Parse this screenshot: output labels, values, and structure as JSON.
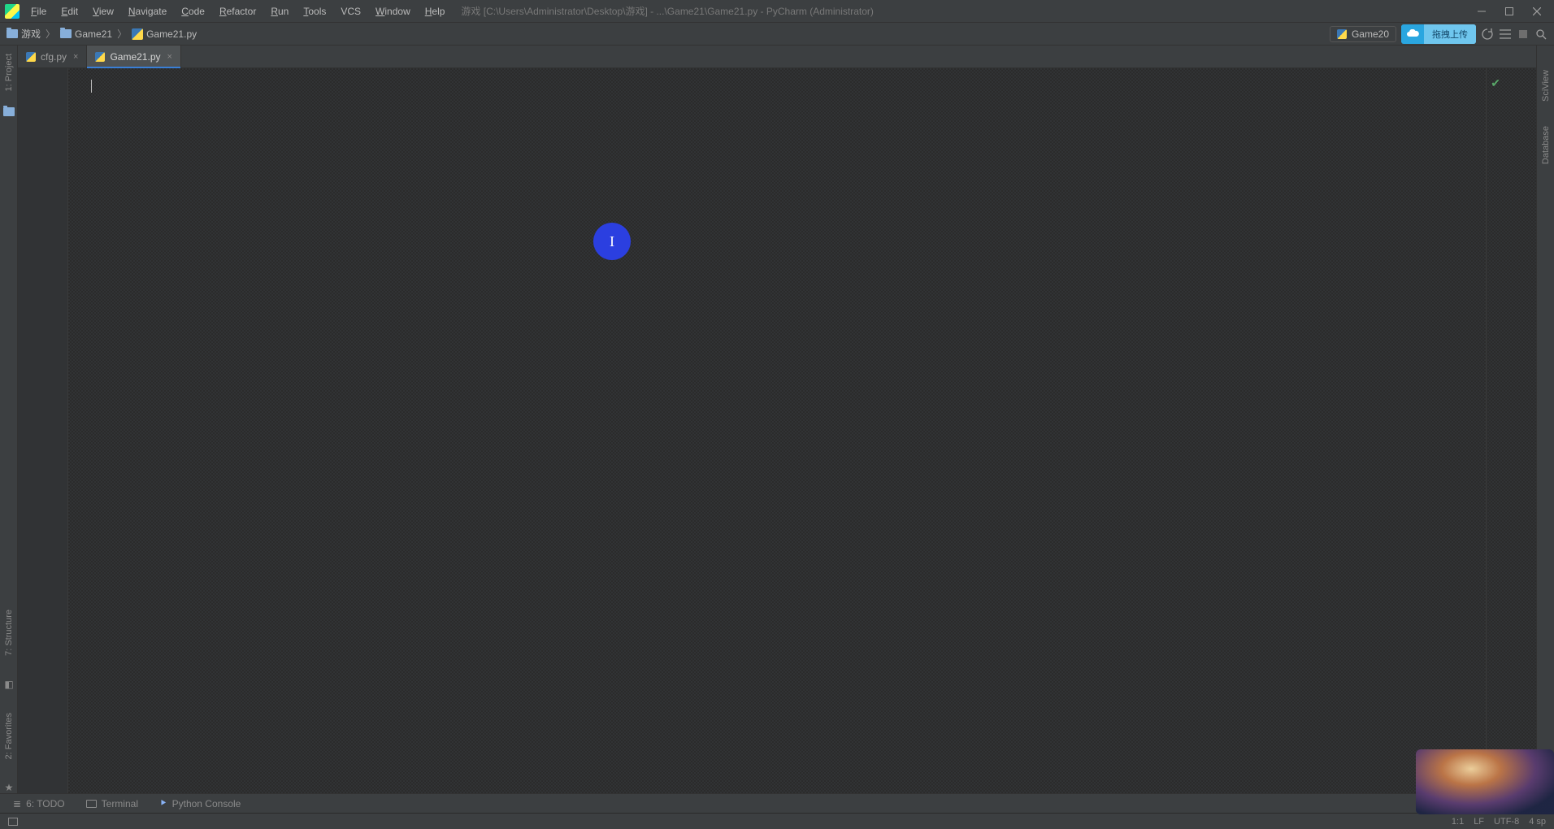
{
  "menu": {
    "file": "File",
    "edit": "Edit",
    "view": "View",
    "navigate": "Navigate",
    "code": "Code",
    "refactor": "Refactor",
    "run": "Run",
    "tools": "Tools",
    "vcs": "VCS",
    "window": "Window",
    "help": "Help"
  },
  "title": "游戏 [C:\\Users\\Administrator\\Desktop\\游戏] - ...\\Game21\\Game21.py - PyCharm (Administrator)",
  "breadcrumb": {
    "root": "游戏",
    "folder": "Game21",
    "file": "Game21.py"
  },
  "run_config": "Game20",
  "upload_label": "拖拽上传",
  "tabs": [
    {
      "label": "cfg.py",
      "active": false
    },
    {
      "label": "Game21.py",
      "active": true
    }
  ],
  "left_tools": {
    "project": "1: Project",
    "structure": "7: Structure",
    "favorites": "2: Favorites"
  },
  "right_tools": {
    "sciview": "SciView",
    "database": "Database"
  },
  "bottom_tools": {
    "todo": "6: TODO",
    "terminal": "Terminal",
    "python_console": "Python Console"
  },
  "status": {
    "position": "1:1",
    "line_sep": "LF",
    "encoding": "UTF-8",
    "indent": "4 sp"
  },
  "click_marker": "I"
}
